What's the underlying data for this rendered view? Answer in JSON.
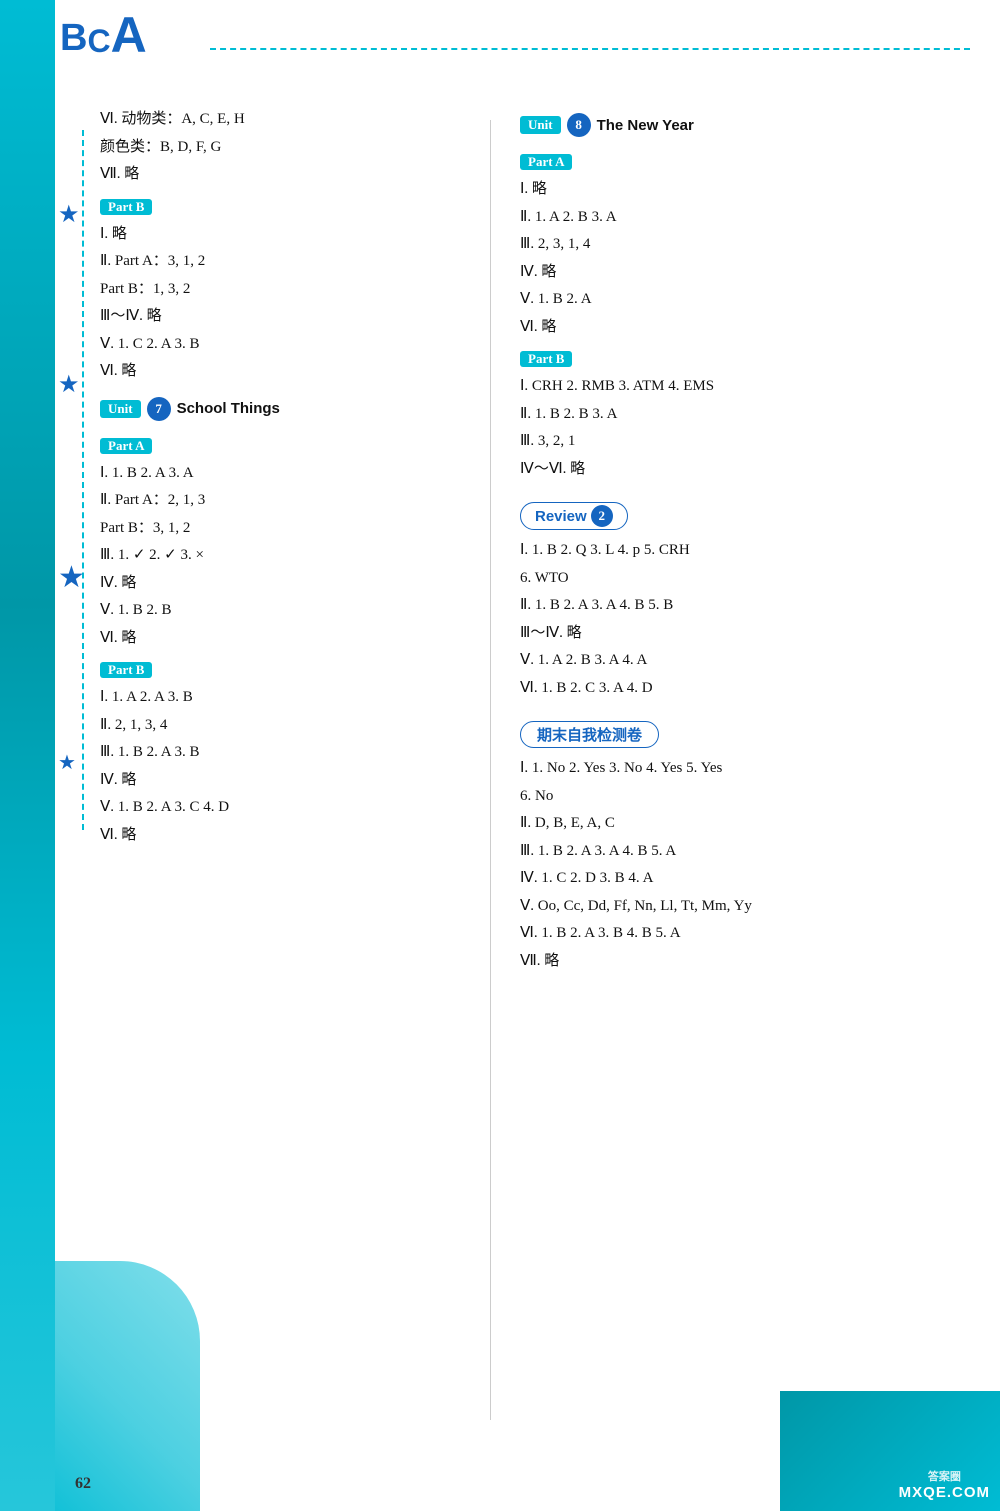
{
  "page": {
    "number": "62",
    "watermark": "MXQE.COM",
    "watermark_top": "答案圈"
  },
  "bca": {
    "b": "B",
    "c": "C",
    "a": "A"
  },
  "left_col": {
    "vi_animals": "Ⅵ. 动物类：A, C, E, H",
    "vi_colors": "    颜色类：B, D, F, G",
    "vii": "Ⅶ. 略",
    "part_b_label": "Part B",
    "i": "Ⅰ. 略",
    "ii_parta": "Ⅱ. Part A：3, 1, 2",
    "ii_partb": "    Part B：1, 3, 2",
    "iii_iv": "Ⅲ～Ⅳ. 略",
    "v": "Ⅴ. 1. C  2. A  3. B",
    "vi": "Ⅵ. 略",
    "unit7_label": "Unit",
    "unit7_num": "7",
    "unit7_title": "School Things",
    "part_a_label": "Part A",
    "u7_pa_i": "Ⅰ. 1. B  2. A  3. A",
    "u7_pa_ii_a": "Ⅱ. Part A：2, 1, 3",
    "u7_pa_ii_b": "    Part B：3, 1, 2",
    "u7_pa_iii": "Ⅲ. 1. ✓  2. ✓  3. ×",
    "u7_pa_iv": "Ⅳ. 略",
    "u7_pa_v": "Ⅴ. 1. B  2. B",
    "u7_pa_vi": "Ⅵ. 略",
    "part_b2_label": "Part B",
    "u7_pb_i": "Ⅰ. 1. A  2. A  3. B",
    "u7_pb_ii": "Ⅱ. 2, 1, 3, 4",
    "u7_pb_iii": "Ⅲ. 1. B  2. A  3. B",
    "u7_pb_iv": "Ⅳ. 略",
    "u7_pb_v": "Ⅴ. 1. B  2. A  3. C  4. D",
    "u7_pb_vi": "Ⅵ. 略"
  },
  "right_col": {
    "unit8_label": "Unit",
    "unit8_num": "8",
    "unit8_title": "The New Year",
    "part_a_label": "Part A",
    "u8_pa_i": "Ⅰ. 略",
    "u8_pa_ii": "Ⅱ. 1. A  2. B  3. A",
    "u8_pa_iii": "Ⅲ. 2, 3, 1, 4",
    "u8_pa_iv": "Ⅳ. 略",
    "u8_pa_v": "Ⅴ. 1. B  2. A",
    "u8_pa_vi": "Ⅵ. 略",
    "part_b_label": "Part B",
    "u8_pb_i": "Ⅰ. CRH  2. RMB  3. ATM  4. EMS",
    "u8_pb_ii": "Ⅱ. 1. B  2. B  3. A",
    "u8_pb_iii": "Ⅲ. 3, 2, 1",
    "u8_pb_iv_vi": "Ⅳ～Ⅵ. 略",
    "review2_text": "Review",
    "review2_num": "2",
    "r2_i_a": "Ⅰ. 1. B  2. Q  3. L  4. p  5. CRH",
    "r2_i_b": "   6. WTO",
    "r2_ii": "Ⅱ. 1. B  2. A  3. A  4. B  5. B",
    "r2_iii_iv": "Ⅲ～Ⅳ. 略",
    "r2_v": "Ⅴ. 1. A  2. B  3. A  4. A",
    "r2_vi": "Ⅵ. 1. B  2. C  3. A  4. D",
    "qimo_text": "期末自我检测卷",
    "qm_i_a": "Ⅰ. 1. No  2. Yes  3. No  4. Yes  5. Yes",
    "qm_i_b": "   6. No",
    "qm_ii": "Ⅱ. D, B, E, A, C",
    "qm_iii": "Ⅲ. 1. B  2. A  3. A  4. B  5. A",
    "qm_iv": "Ⅳ. 1. C  2. D  3. B  4. A",
    "qm_v": "Ⅴ. Oo, Cc, Dd, Ff, Nn, Ll, Tt, Mm, Yy",
    "qm_vi": "Ⅵ. 1. B  2. A  3. B  4. B  5. A",
    "qm_vii": "Ⅶ. 略"
  }
}
